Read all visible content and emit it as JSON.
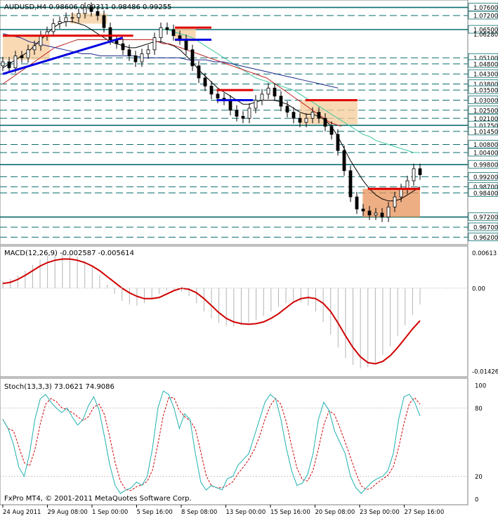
{
  "window": {
    "symbol_line": "AUDUSD,H4  0.98606 0.99311 0.98486 0.99255",
    "footer": "FxPro MT4, © 2001-2011 MetaQuotes Software Corp."
  },
  "colors": {
    "background": "#ffffff",
    "grid": "#c8c8c8",
    "level_line": "#0b6e6e",
    "bull_candle": "#000000",
    "ma_short": "#000000",
    "ma_teal": "#3cc7a0",
    "ma_red": "#c02020",
    "ma_blue": "#1a2a8a",
    "zone_fill": "#f5cc9a",
    "zone_fill_strong": "#e8935a",
    "resistance": "#e00000",
    "support": "#0000e0",
    "macd_signal": "#d00000",
    "macd_hist": "#b4b4b4",
    "stoch_main": "#20b0b0",
    "stoch_signal": "#d00000"
  },
  "chart_data": [
    {
      "type": "line",
      "panel": "price",
      "title": "AUDUSD,H4",
      "ohlc_header": [
        "0.98606",
        "0.99311",
        "0.98486",
        "0.99255"
      ],
      "y_range": [
        0.959,
        1.079
      ],
      "price_tick_labels": [
        "1.07600",
        "1.07200",
        "1.06500",
        "1.06280",
        "1.05100",
        "1.04800",
        "1.04300",
        "1.03800",
        "1.03500",
        "1.03000",
        "1.02500",
        "1.02100",
        "1.01750",
        "1.01450",
        "1.00800",
        "1.00400",
        "0.99800",
        "0.99200",
        "0.98700",
        "0.98400",
        "0.97200",
        "0.96700",
        "0.96200"
      ],
      "horizontal_levels": [
        1.076,
        1.072,
        1.065,
        1.051,
        1.048,
        1.043,
        1.038,
        1.035,
        1.03,
        1.025,
        1.021,
        1.0175,
        1.0145,
        1.008,
        1.004,
        0.998,
        0.992,
        0.987,
        0.984,
        0.972,
        0.967,
        0.962
      ],
      "solid_levels": [
        1.076,
        1.065,
        1.0175,
        0.998,
        0.972
      ],
      "close_series": [
        1.049,
        1.046,
        1.052,
        1.051,
        1.055,
        1.057,
        1.062,
        1.064,
        1.068,
        1.069,
        1.071,
        1.071,
        1.073,
        1.076,
        1.074,
        1.072,
        1.066,
        1.06,
        1.058,
        1.055,
        1.052,
        1.049,
        1.053,
        1.055,
        1.061,
        1.066,
        1.065,
        1.062,
        1.06,
        1.055,
        1.047,
        1.041,
        1.037,
        1.033,
        1.031,
        1.03,
        1.025,
        1.022,
        1.021,
        1.026,
        1.03,
        1.033,
        1.036,
        1.032,
        1.027,
        1.024,
        1.021,
        1.019,
        1.021,
        1.024,
        1.021,
        1.017,
        1.013,
        1.005,
        0.995,
        0.982,
        0.976,
        0.975,
        0.973,
        0.974,
        0.972,
        0.977,
        0.982,
        0.986,
        0.99,
        0.996,
        0.993
      ],
      "ma_series": [
        {
          "color_key": "ma_short",
          "values": [
            1.046,
            1.048,
            1.05,
            1.052,
            1.054,
            1.057,
            1.06,
            1.063,
            1.066,
            1.068,
            1.069,
            1.069,
            1.068,
            1.067,
            1.065,
            1.063,
            1.061,
            1.059,
            1.058,
            1.057,
            1.056,
            1.056,
            1.057,
            1.058,
            1.059,
            1.059,
            1.058,
            1.057,
            1.055,
            1.052,
            1.049,
            1.045,
            1.042,
            1.039,
            1.036,
            1.034,
            1.032,
            1.03,
            1.028,
            1.028,
            1.029,
            1.03,
            1.03,
            1.03,
            1.029,
            1.028,
            1.026,
            1.024,
            1.023,
            1.023,
            1.022,
            1.02,
            1.017,
            1.012,
            1.006,
            1.0,
            0.995,
            0.99,
            0.986,
            0.983,
            0.981,
            0.98,
            0.98,
            0.981,
            0.983,
            0.985,
            0.987
          ]
        },
        {
          "color_key": "ma_teal",
          "values": [
            null,
            null,
            null,
            null,
            null,
            null,
            null,
            null,
            null,
            null,
            null,
            null,
            null,
            null,
            null,
            null,
            null,
            null,
            null,
            null,
            null,
            null,
            null,
            null,
            null,
            1.065,
            1.065,
            1.064,
            1.063,
            1.062,
            1.061,
            1.059,
            1.057,
            1.055,
            1.053,
            1.051,
            1.049,
            1.047,
            1.045,
            1.043,
            1.041,
            1.04,
            1.039,
            1.038,
            1.037,
            1.036,
            1.035,
            1.033,
            1.031,
            1.029,
            1.027,
            1.025,
            1.023,
            1.021,
            1.019,
            1.017,
            1.015,
            1.013,
            1.012,
            1.01,
            1.009,
            1.008,
            1.007,
            1.006,
            1.005,
            1.004,
            1.004
          ]
        },
        {
          "color_key": "ma_red",
          "values": [
            1.038,
            1.04,
            1.042,
            1.044,
            1.046,
            1.048,
            1.05,
            1.052,
            1.054,
            1.056,
            1.057,
            1.058,
            1.059,
            1.06,
            1.06,
            1.06,
            1.06,
            1.06,
            1.06,
            1.06,
            1.06,
            1.06,
            1.06,
            1.06,
            1.06,
            1.06,
            1.06,
            1.059,
            1.058,
            1.058,
            1.057,
            1.056,
            1.055,
            1.054,
            1.053,
            1.052,
            1.051,
            1.05,
            1.049,
            1.048,
            1.047,
            1.046,
            1.045,
            1.044,
            1.043,
            1.042,
            1.041,
            1.039,
            1.037,
            1.035,
            1.033,
            1.031,
            1.029,
            1.027,
            1.025,
            1.023,
            1.021,
            1.019,
            1.018,
            1.017
          ]
        },
        {
          "color_key": "ma_blue",
          "values": [
            1.063,
            1.062,
            1.061,
            1.059,
            1.058,
            1.057,
            1.056,
            1.055,
            1.054,
            1.053,
            1.053,
            1.052,
            1.052,
            1.052,
            1.052,
            1.052,
            1.051,
            1.051,
            1.051,
            1.051,
            1.051,
            1.05,
            1.05,
            1.05,
            1.049,
            1.049,
            1.048,
            1.047,
            1.046,
            1.045,
            1.044,
            1.043,
            1.042,
            1.041,
            1.04,
            1.039,
            1.038,
            1.037,
            1.036
          ]
        }
      ],
      "zones": [
        {
          "x_range": [
            0,
            9
          ],
          "y_range": [
            1.05,
            1.062
          ],
          "color_key": "zone_fill"
        },
        {
          "x_range": [
            13,
            20
          ],
          "y_range": [
            1.068,
            1.073
          ],
          "color_key": "zone_fill"
        },
        {
          "x_range": [
            33,
            37
          ],
          "y_range": [
            1.059,
            1.066
          ],
          "color_key": "zone_fill"
        },
        {
          "x_range": [
            57,
            68
          ],
          "y_range": [
            1.018,
            1.03
          ],
          "color_key": "zone_fill"
        },
        {
          "x_range": [
            69,
            80
          ],
          "y_range": [
            0.972,
            0.986
          ],
          "color_key": "zone_fill_strong"
        }
      ],
      "resistance_segments": [
        {
          "x_range": [
            0,
            25
          ],
          "y": 1.062
        },
        {
          "x_range": [
            33,
            40
          ],
          "y": 1.066
        },
        {
          "x_range": [
            41,
            48
          ],
          "y": 1.035
        },
        {
          "x_range": [
            58,
            68
          ],
          "y": 1.03
        },
        {
          "x_range": [
            70,
            80
          ],
          "y": 0.986
        }
      ],
      "support_segments": [
        {
          "x_range": [
            33,
            40
          ],
          "y": 1.06
        },
        {
          "x_range": [
            41,
            48
          ],
          "y": 1.03
        }
      ],
      "trendlines": [
        {
          "from": [
            0,
            1.043
          ],
          "to": [
            23,
            1.061
          ],
          "color_key": "support"
        }
      ],
      "x_tick_labels": [
        "24 Aug 2011",
        "29 Aug 08:00",
        "1 Sep 00:00",
        "5 Sep 16:00",
        "8 Sep 08:00",
        "13 Sep 00:00",
        "15 Sep 16:00",
        "20 Sep 08:00",
        "23 Sep 00:00",
        "27 Sep 16:00"
      ]
    },
    {
      "type": "line",
      "panel": "macd",
      "title": "MACD(12,26,9) -0.002587 -0.005614",
      "y_range": [
        -0.015,
        0.007
      ],
      "tick_labels": [
        "0.00613",
        "0.00",
        "-0.01426"
      ],
      "histogram": [
        0.0012,
        0.0016,
        0.0022,
        0.003,
        0.004,
        0.0049,
        0.0056,
        0.0059,
        0.006,
        0.0058,
        0.0054,
        0.0047,
        0.0036,
        0.0022,
        0.0006,
        -0.001,
        -0.0022,
        -0.0028,
        -0.003,
        -0.0026,
        -0.0018,
        -0.001,
        -0.0004,
        -0.0002,
        -0.0006,
        -0.0014,
        -0.0026,
        -0.004,
        -0.0052,
        -0.006,
        -0.0065,
        -0.0066,
        -0.0064,
        -0.006,
        -0.0055,
        -0.0048,
        -0.004,
        -0.0032,
        -0.0026,
        -0.0022,
        -0.0024,
        -0.003,
        -0.004,
        -0.0058,
        -0.008,
        -0.0102,
        -0.012,
        -0.0132,
        -0.0138,
        -0.0136,
        -0.0128,
        -0.0115,
        -0.01,
        -0.0082,
        -0.0064,
        -0.0046,
        -0.0028
      ],
      "signal": [
        0.0008,
        0.001,
        0.0015,
        0.0022,
        0.003,
        0.0038,
        0.0044,
        0.0048,
        0.005,
        0.005,
        0.0048,
        0.0044,
        0.0038,
        0.003,
        0.002,
        0.001,
        0.0,
        -0.0008,
        -0.0014,
        -0.0018,
        -0.0018,
        -0.0016,
        -0.001,
        -0.0004,
        0.0,
        -0.0002,
        -0.0008,
        -0.0018,
        -0.003,
        -0.0042,
        -0.0052,
        -0.0058,
        -0.0061,
        -0.0062,
        -0.0061,
        -0.0058,
        -0.0052,
        -0.0044,
        -0.0034,
        -0.0024,
        -0.0018,
        -0.0016,
        -0.0018,
        -0.0026,
        -0.004,
        -0.006,
        -0.0082,
        -0.0102,
        -0.0118,
        -0.0128,
        -0.013,
        -0.0126,
        -0.0116,
        -0.0102,
        -0.0086,
        -0.007,
        -0.0056
      ]
    },
    {
      "type": "line",
      "panel": "stochastic",
      "title": "Stoch(13,3,3) 73.0621 74.9086",
      "y_range": [
        0,
        100
      ],
      "tick_labels": [
        "100",
        "80",
        "20",
        "0"
      ],
      "reference_levels": [
        80,
        20
      ],
      "main": [
        70,
        62,
        48,
        28,
        20,
        40,
        70,
        88,
        92,
        85,
        80,
        76,
        80,
        72,
        65,
        70,
        82,
        90,
        78,
        55,
        30,
        12,
        5,
        8,
        10,
        15,
        12,
        20,
        45,
        80,
        95,
        92,
        80,
        62,
        75,
        70,
        40,
        15,
        8,
        12,
        10,
        8,
        18,
        20,
        30,
        35,
        40,
        55,
        70,
        85,
        92,
        88,
        70,
        45,
        25,
        12,
        14,
        22,
        40,
        70,
        85,
        78,
        60,
        50,
        40,
        20,
        10,
        5,
        10,
        15,
        18,
        20,
        25,
        40,
        70,
        90,
        92,
        85,
        73
      ]
    }
  ]
}
